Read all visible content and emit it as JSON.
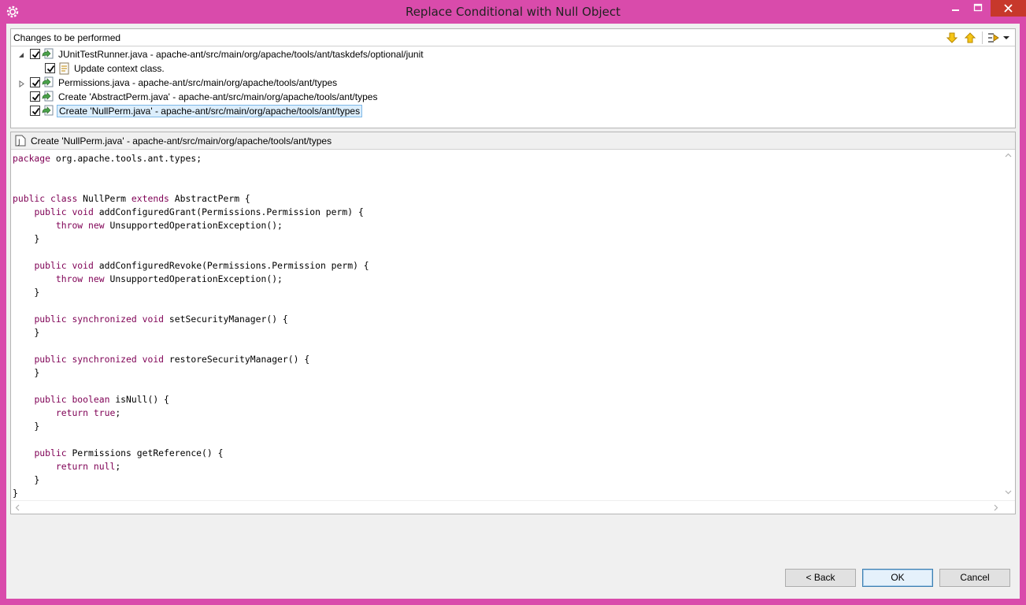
{
  "window": {
    "title": "Replace Conditional with Null Object"
  },
  "changes": {
    "header": "Changes to be performed",
    "items": [
      {
        "label": "JUnitTestRunner.java - apache-ant/src/main/org/apache/tools/ant/taskdefs/optional/junit",
        "checked": true,
        "expanded": true
      },
      {
        "label": "Update context class.",
        "checked": true
      },
      {
        "label": "Permissions.java - apache-ant/src/main/org/apache/tools/ant/types",
        "checked": true,
        "expanded": false
      },
      {
        "label": "Create 'AbstractPerm.java' - apache-ant/src/main/org/apache/tools/ant/types",
        "checked": true
      },
      {
        "label": "Create 'NullPerm.java' - apache-ant/src/main/org/apache/tools/ant/types",
        "checked": true,
        "selected": true
      }
    ]
  },
  "preview": {
    "header": "Create 'NullPerm.java' - apache-ant/src/main/org/apache/tools/ant/types",
    "code": [
      "package org.apache.tools.ant.types;",
      "",
      "",
      "public class NullPerm extends AbstractPerm {",
      "    public void addConfiguredGrant(Permissions.Permission perm) {",
      "        throw new UnsupportedOperationException();",
      "    }",
      "",
      "    public void addConfiguredRevoke(Permissions.Permission perm) {",
      "        throw new UnsupportedOperationException();",
      "    }",
      "",
      "    public synchronized void setSecurityManager() {",
      "    }",
      "",
      "    public synchronized void restoreSecurityManager() {",
      "    }",
      "",
      "    public boolean isNull() {",
      "        return true;",
      "    }",
      "",
      "    public Permissions getReference() {",
      "        return null;",
      "    }",
      "}"
    ],
    "keywords": [
      "package",
      "public",
      "class",
      "extends",
      "void",
      "throw",
      "new",
      "synchronized",
      "boolean",
      "return",
      "true",
      "null"
    ]
  },
  "buttons": {
    "back": "< Back",
    "ok": "OK",
    "cancel": "Cancel"
  },
  "colors": {
    "frame": "#d94bab",
    "keyword": "#7f0055",
    "selection": "#dceefc"
  },
  "icons": {
    "app": "gear-icon",
    "next_change": "arrow-down-icon",
    "prev_change": "arrow-up-icon",
    "filter": "filter-icon",
    "java_file": "java-file-icon"
  }
}
